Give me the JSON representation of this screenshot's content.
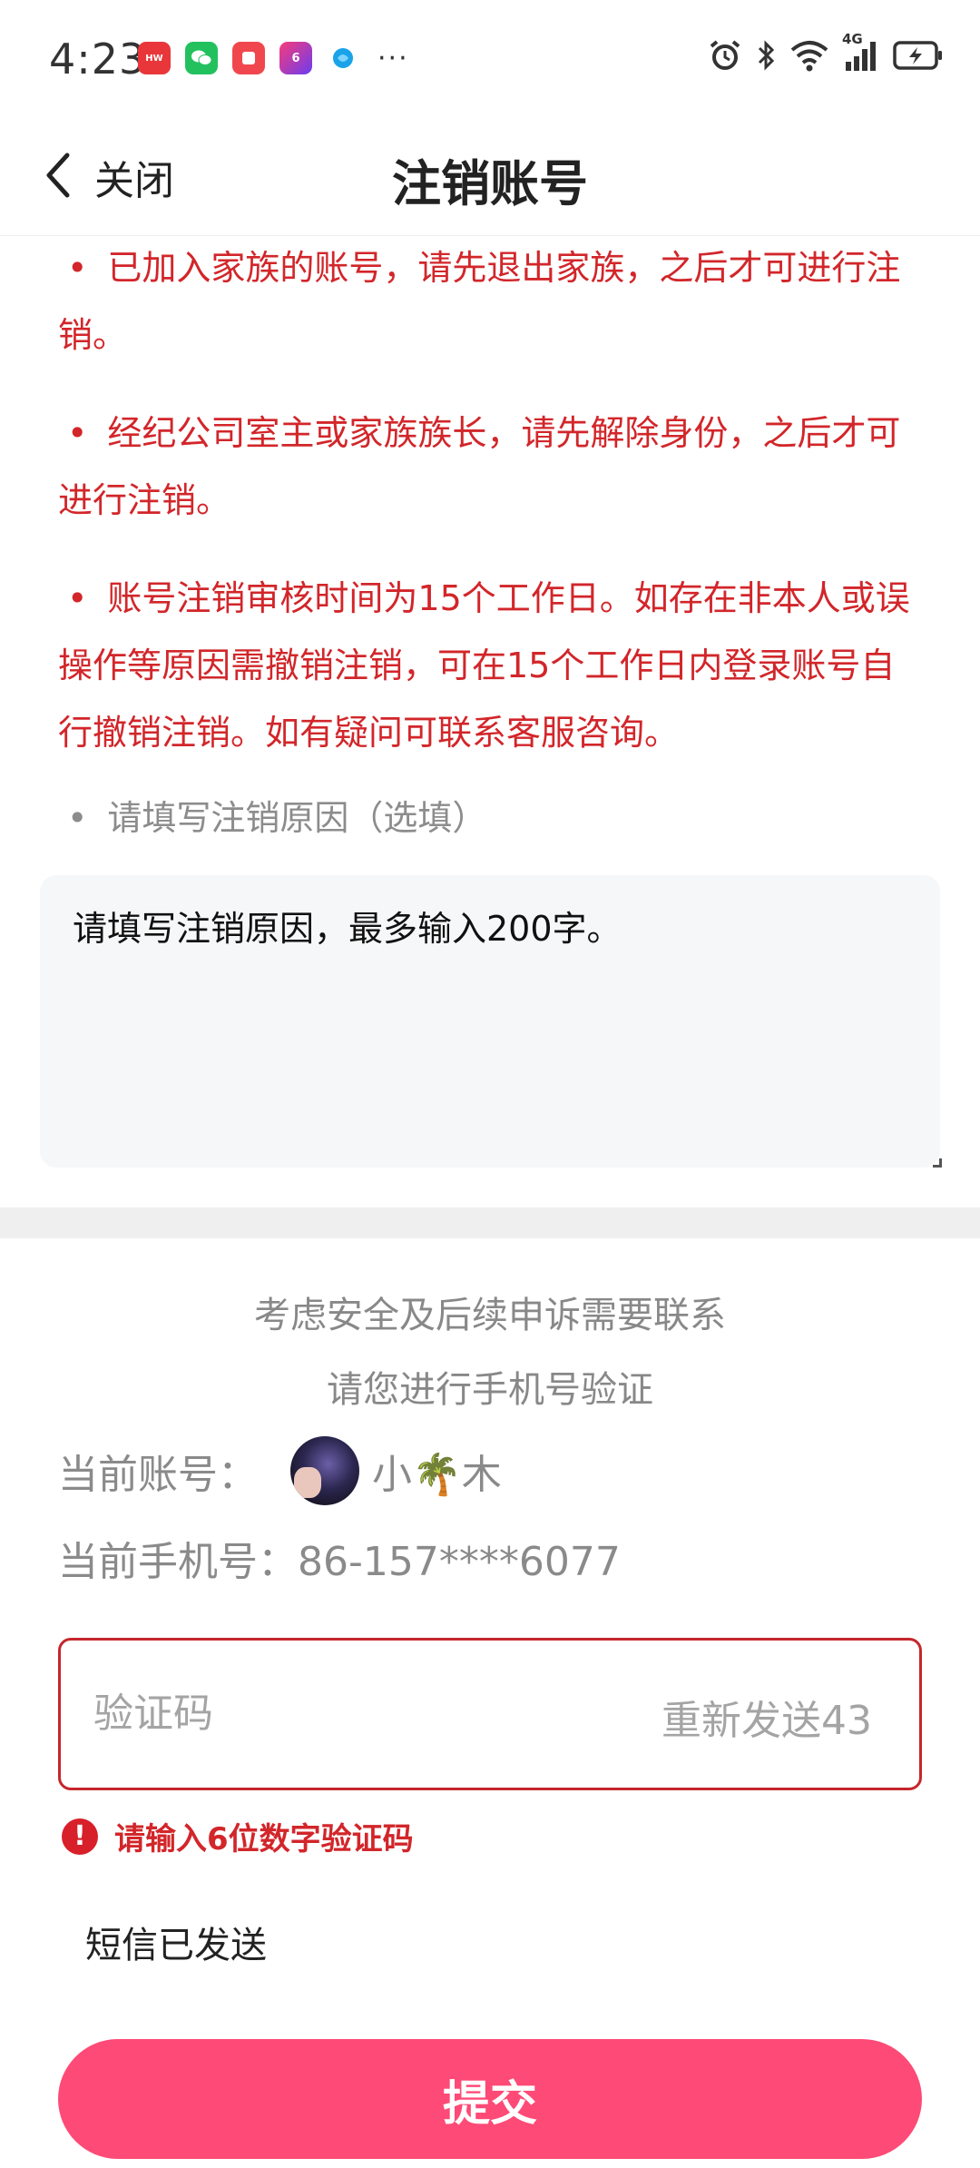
{
  "status_bar": {
    "time": "4:23",
    "app_icons": [
      {
        "name": "huawei-app-icon",
        "color": "#e8363a",
        "glyph": "HW"
      },
      {
        "name": "wechat-app-icon",
        "color": "#22c15e",
        "glyph": "✉"
      },
      {
        "name": "red-app-icon",
        "color": "#f0474f",
        "glyph": "▣"
      },
      {
        "name": "six-app-icon",
        "color": "#7a3cf0",
        "glyph": "6"
      },
      {
        "name": "blue-app-icon",
        "color": "#1aa3e8",
        "glyph": "●"
      }
    ],
    "more": "···",
    "network": "4G"
  },
  "nav": {
    "close_label": "关闭",
    "title": "注销账号"
  },
  "notices": [
    "已加入家族的账号，请先退出家族，之后才可进行注销。",
    "经纪公司室主或家族族长，请先解除身份，之后才可进行注销。",
    "账号注销审核时间为15个工作日。如存在非本人或误操作等原因需撤销注销，可在15个工作日内登录账号自行撤销注销。如有疑问可联系客服咨询。"
  ],
  "bullet": "•",
  "reason": {
    "label": "请填写注销原因（选填）",
    "placeholder": "请填写注销原因，最多输入200字。"
  },
  "verify": {
    "hint_line1": "考虑安全及后续申诉需要联系",
    "hint_line2": "请您进行手机号验证",
    "account_label": "当前账号：",
    "nickname": "小🌴木",
    "phone_label": "当前手机号：",
    "phone": "86-157****6077",
    "code_placeholder": "验证码",
    "resend_label": "重新发送43",
    "error_text": "请输入6位数字验证码",
    "sms_status": "短信已发送"
  },
  "submit_label": "提交",
  "colors": {
    "accent": "#fe4a76",
    "warning_text": "#d2262a"
  }
}
